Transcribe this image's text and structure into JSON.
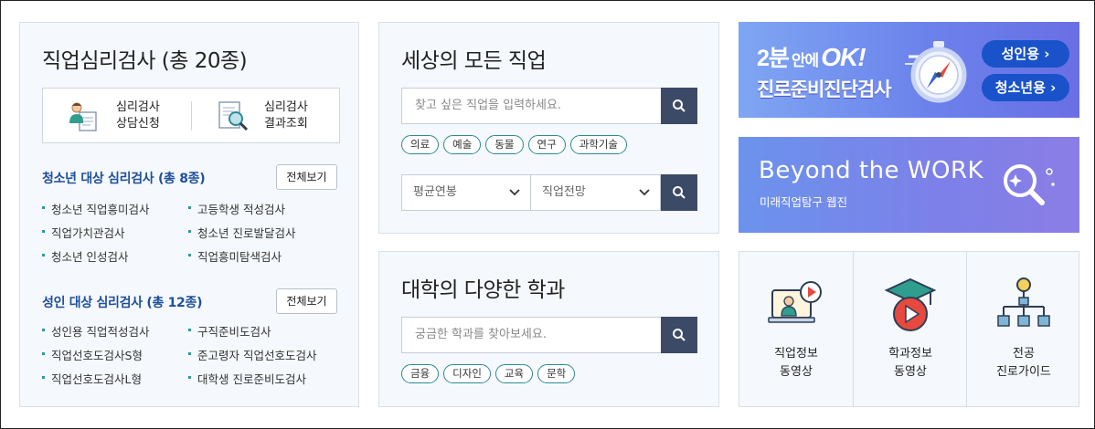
{
  "tests_panel": {
    "title": "직업심리검사 (총 20종)",
    "services": [
      {
        "label_line1": "심리검사",
        "label_line2": "상담신청",
        "icon": "counselor-icon"
      },
      {
        "label_line1": "심리검사",
        "label_line2": "결과조회",
        "icon": "document-search-icon"
      }
    ],
    "youth": {
      "title": "청소년 대상 심리검사 (총 8종)",
      "more_label": "전체보기",
      "items": [
        "청소년 직업흥미검사",
        "고등학생 적성검사",
        "직업가치관검사",
        "청소년 진로발달검사",
        "청소년 인성검사",
        "직업흥미탐색검사"
      ]
    },
    "adult": {
      "title": "성인 대상 심리검사 (총 12종)",
      "more_label": "전체보기",
      "items": [
        "성인용 직업적성검사",
        "구직준비도검사",
        "직업선호도검사S형",
        "준고령자 직업선호도검사",
        "직업선호도검사L형",
        "대학생 진로준비도검사"
      ]
    }
  },
  "jobs_panel": {
    "title": "세상의 모든 직업",
    "search_placeholder": "찾고 싶은 직업을 입력하세요.",
    "tags": [
      "의료",
      "예술",
      "동물",
      "연구",
      "과학기술"
    ],
    "select_salary": "평균연봉",
    "select_outlook": "직업전망"
  },
  "majors_panel": {
    "title": "대학의 다양한 학과",
    "search_placeholder": "궁금한 학과를 찾아보세요.",
    "tags": [
      "금융",
      "디자인",
      "교육",
      "문학"
    ]
  },
  "banner_test": {
    "line1_a": "2분",
    "line1_b": "안에",
    "line1_c": "OK!",
    "line2": "진로준비진단검사",
    "btn_adult": "성인용 ›",
    "btn_youth": "청소년용 ›",
    "colors": {
      "accent": "#1a52c9",
      "bg_start": "#7fa6f2",
      "bg_end": "#6a6fe3"
    }
  },
  "banner_work": {
    "title": "Beyond the WORK",
    "subtitle": "미래직업탐구 웹진"
  },
  "video_links": [
    {
      "line1": "직업정보",
      "line2": "동영상",
      "icon": "video-lecture-icon"
    },
    {
      "line1": "학과정보",
      "line2": "동영상",
      "icon": "graduation-play-icon"
    },
    {
      "line1": "전공",
      "line2": "진로가이드",
      "icon": "hierarchy-icon"
    }
  ]
}
